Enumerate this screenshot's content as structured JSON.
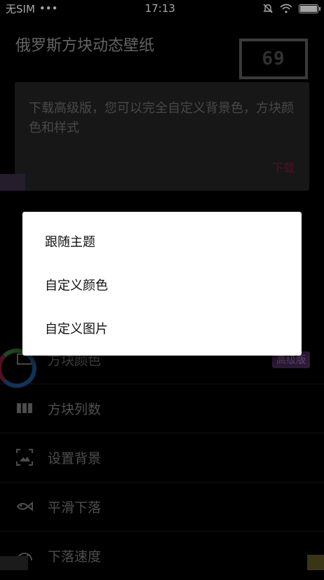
{
  "status_bar": {
    "carrier": "无SIM",
    "dots": "•••",
    "time": "17:13"
  },
  "header": {
    "title": "俄罗斯方块动态壁纸",
    "score": "69"
  },
  "premium_card": {
    "text": "下载高级版，您可以完全自定义背景色，方块颜色和样式",
    "download_label": "下载"
  },
  "settings": [
    {
      "label": "方块颜色",
      "badge": "高级版",
      "icon": "color-palette-icon"
    },
    {
      "label": "方块列数",
      "badge": "",
      "icon": "columns-icon"
    },
    {
      "label": "设置背景",
      "badge": "",
      "icon": "background-image-icon"
    },
    {
      "label": "平滑下落",
      "badge": "",
      "icon": "fish-icon"
    },
    {
      "label": "下落速度",
      "badge": "",
      "icon": "speedometer-icon"
    }
  ],
  "dialog": {
    "options": [
      "跟随主题",
      "自定义颜色",
      "自定义图片"
    ]
  },
  "colors": {
    "accent": "#8b1138",
    "badge_bg": "#4a2a5e",
    "dialog_bg": "#ffffff"
  }
}
